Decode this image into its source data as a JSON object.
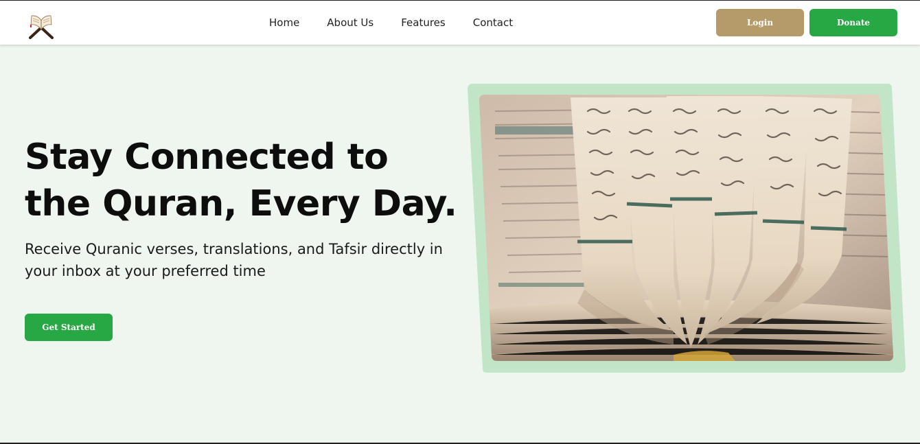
{
  "navbar": {
    "logo_icon": "quran-stand-icon",
    "links": [
      "Home",
      "About Us",
      "Features",
      "Contact"
    ],
    "login_label": "Login",
    "donate_label": "Donate"
  },
  "hero": {
    "title": "Stay Connected to the Quran, Every Day.",
    "subtitle": "Receive Quranic verses, translations, and Tafsir directly in your inbox at your preferred time",
    "cta_label": "Get Started",
    "image_icon": "open-quran-photo"
  },
  "colors": {
    "page_bg": "#eef6ef",
    "primary_green": "#28a745",
    "login_tan": "#b59a6a",
    "frame_green": "#c2e5c8"
  }
}
